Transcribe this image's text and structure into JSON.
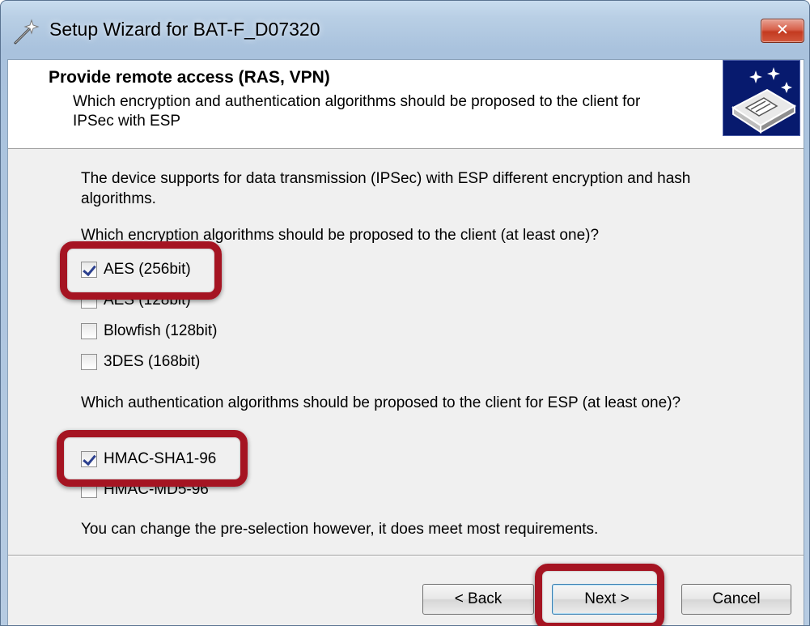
{
  "window": {
    "title": "Setup Wizard for BAT-F_D07320",
    "close_label": "✕"
  },
  "header": {
    "title": "Provide remote access (RAS, VPN)",
    "subtitle": "Which encryption and authentication algorithms should be proposed to the client for IPSec with ESP"
  },
  "body": {
    "intro": "The device supports for data transmission (IPSec) with ESP different encryption and hash algorithms.",
    "encryption_question": "Which encryption algorithms should be proposed to the client (at least one)?",
    "encryption_options": [
      {
        "label": "AES (256bit)",
        "checked": true
      },
      {
        "label": "AES (128bit)",
        "checked": false
      },
      {
        "label": "Blowfish (128bit)",
        "checked": false
      },
      {
        "label": "3DES (168bit)",
        "checked": false
      }
    ],
    "authentication_question": "Which authentication algorithms should be proposed to the client for ESP (at least one)?",
    "authentication_options": [
      {
        "label": "HMAC-SHA1-96",
        "checked": true
      },
      {
        "label": "HMAC-MD5-96",
        "checked": false
      }
    ],
    "note": "You can change the pre-selection however, it does meet most requirements."
  },
  "buttons": {
    "back": "< Back",
    "next": "Next >",
    "cancel": "Cancel"
  },
  "colors": {
    "highlight": "#a51422",
    "logo_background": "#071a6e",
    "close_button": "#c9442a"
  }
}
